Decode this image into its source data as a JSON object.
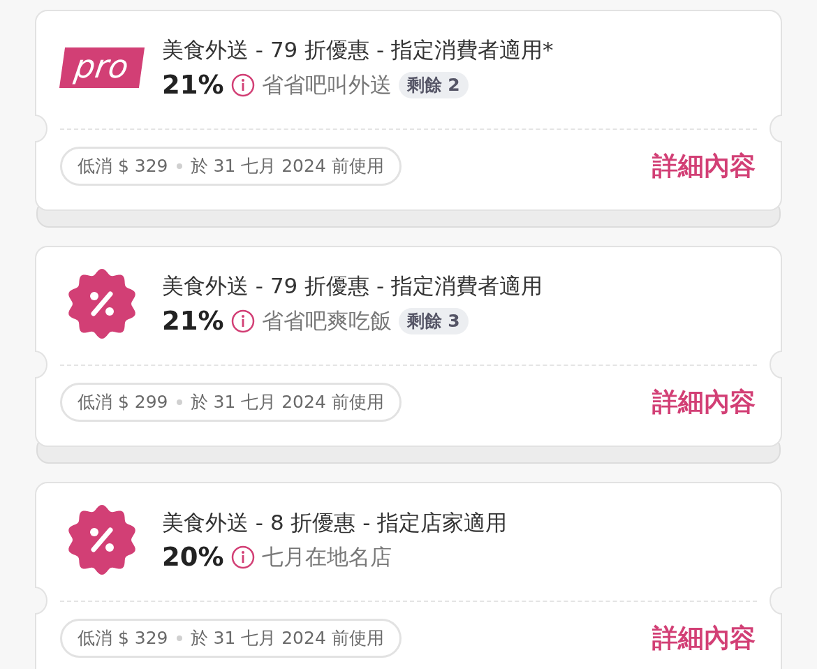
{
  "vouchers": [
    {
      "icon": {
        "kind": "pro",
        "label": "pro"
      },
      "title": "美食外送 - 79 折優惠 - 指定消費者適用*",
      "percent": "21%",
      "campaign": "省省吧叫外送",
      "badge": "剩餘 2",
      "min_spend": "低消 $ 329",
      "expiry": "於 31 七月 2024 前使用",
      "action": "詳細內容",
      "stacked": true
    },
    {
      "icon": {
        "kind": "discount"
      },
      "title": "美食外送 - 79 折優惠 - 指定消費者適用",
      "percent": "21%",
      "campaign": "省省吧爽吃飯",
      "badge": "剩餘 3",
      "min_spend": "低消 $ 299",
      "expiry": "於 31 七月 2024 前使用",
      "action": "詳細內容",
      "stacked": true
    },
    {
      "icon": {
        "kind": "discount"
      },
      "title": "美食外送 - 8 折優惠 - 指定店家適用",
      "percent": "20%",
      "campaign": "七月在地名店",
      "min_spend": "低消 $ 329",
      "expiry": "於 31 七月 2024 前使用",
      "action": "詳細內容"
    }
  ]
}
